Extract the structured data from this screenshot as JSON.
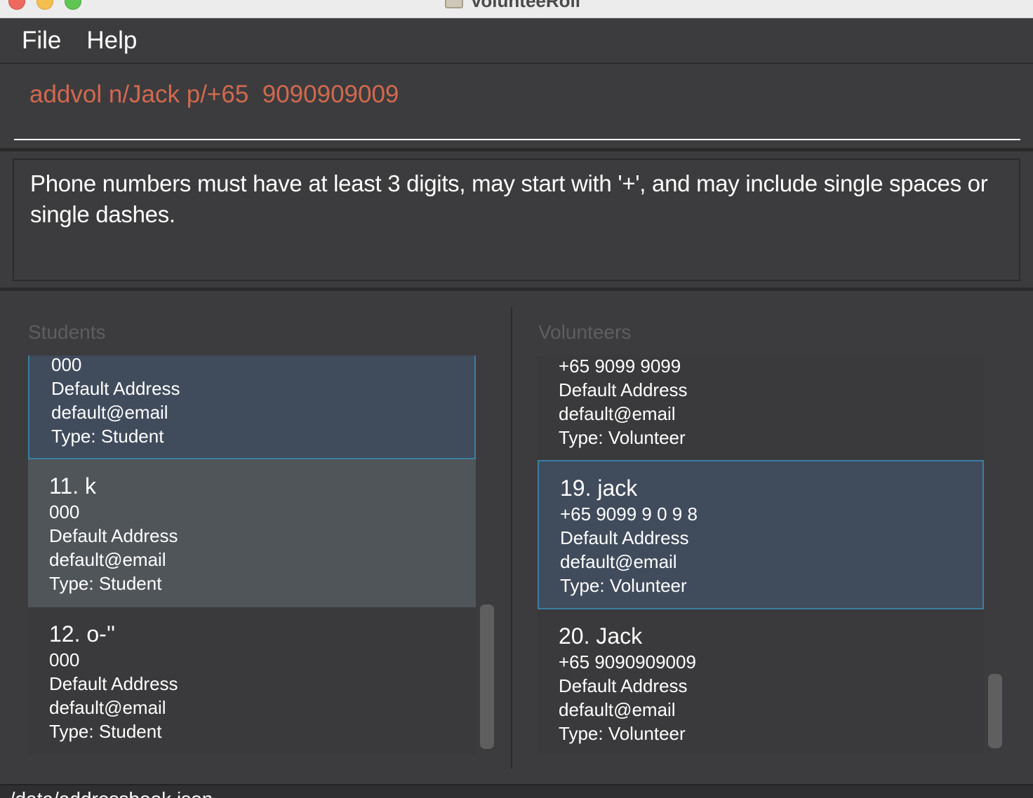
{
  "window": {
    "title": "VolunteeRoll"
  },
  "menu": {
    "file": "File",
    "help": "Help"
  },
  "command": {
    "value": "addvol n/Jack p/+65  9090909009"
  },
  "result": {
    "message": "Phone numbers must have at least 3 digits, may start with '+', and may include single spaces or single dashes."
  },
  "students": {
    "title": "Students",
    "cards": [
      {
        "phone": "000",
        "address": "Default Address",
        "email": "default@email",
        "type": "Type: Student"
      },
      {
        "name": "11. k",
        "phone": "000",
        "address": "Default Address",
        "email": "default@email",
        "type": "Type: Student"
      },
      {
        "name": "12. o-''",
        "phone": "000",
        "address": "Default Address",
        "email": "default@email",
        "type": "Type: Student"
      }
    ]
  },
  "volunteers": {
    "title": "Volunteers",
    "cards": [
      {
        "phone": "+65 9099 9099",
        "address": "Default Address",
        "email": "default@email",
        "type": "Type: Volunteer"
      },
      {
        "name": "19. jack",
        "phone": "+65 9099 9 0 9 8",
        "address": "Default Address",
        "email": "default@email",
        "type": "Type: Volunteer"
      },
      {
        "name": "20. Jack",
        "phone": "+65 9090909009",
        "address": "Default Address",
        "email": "default@email",
        "type": "Type: Volunteer"
      }
    ]
  },
  "status": {
    "path": "./data/addressbook.json"
  },
  "colors": {
    "background": "#3c3c3e",
    "command_text": "#d2694e",
    "selected_card": "#404b5c",
    "selected_border": "#3a7ea0",
    "alt_card": "#50555a"
  }
}
